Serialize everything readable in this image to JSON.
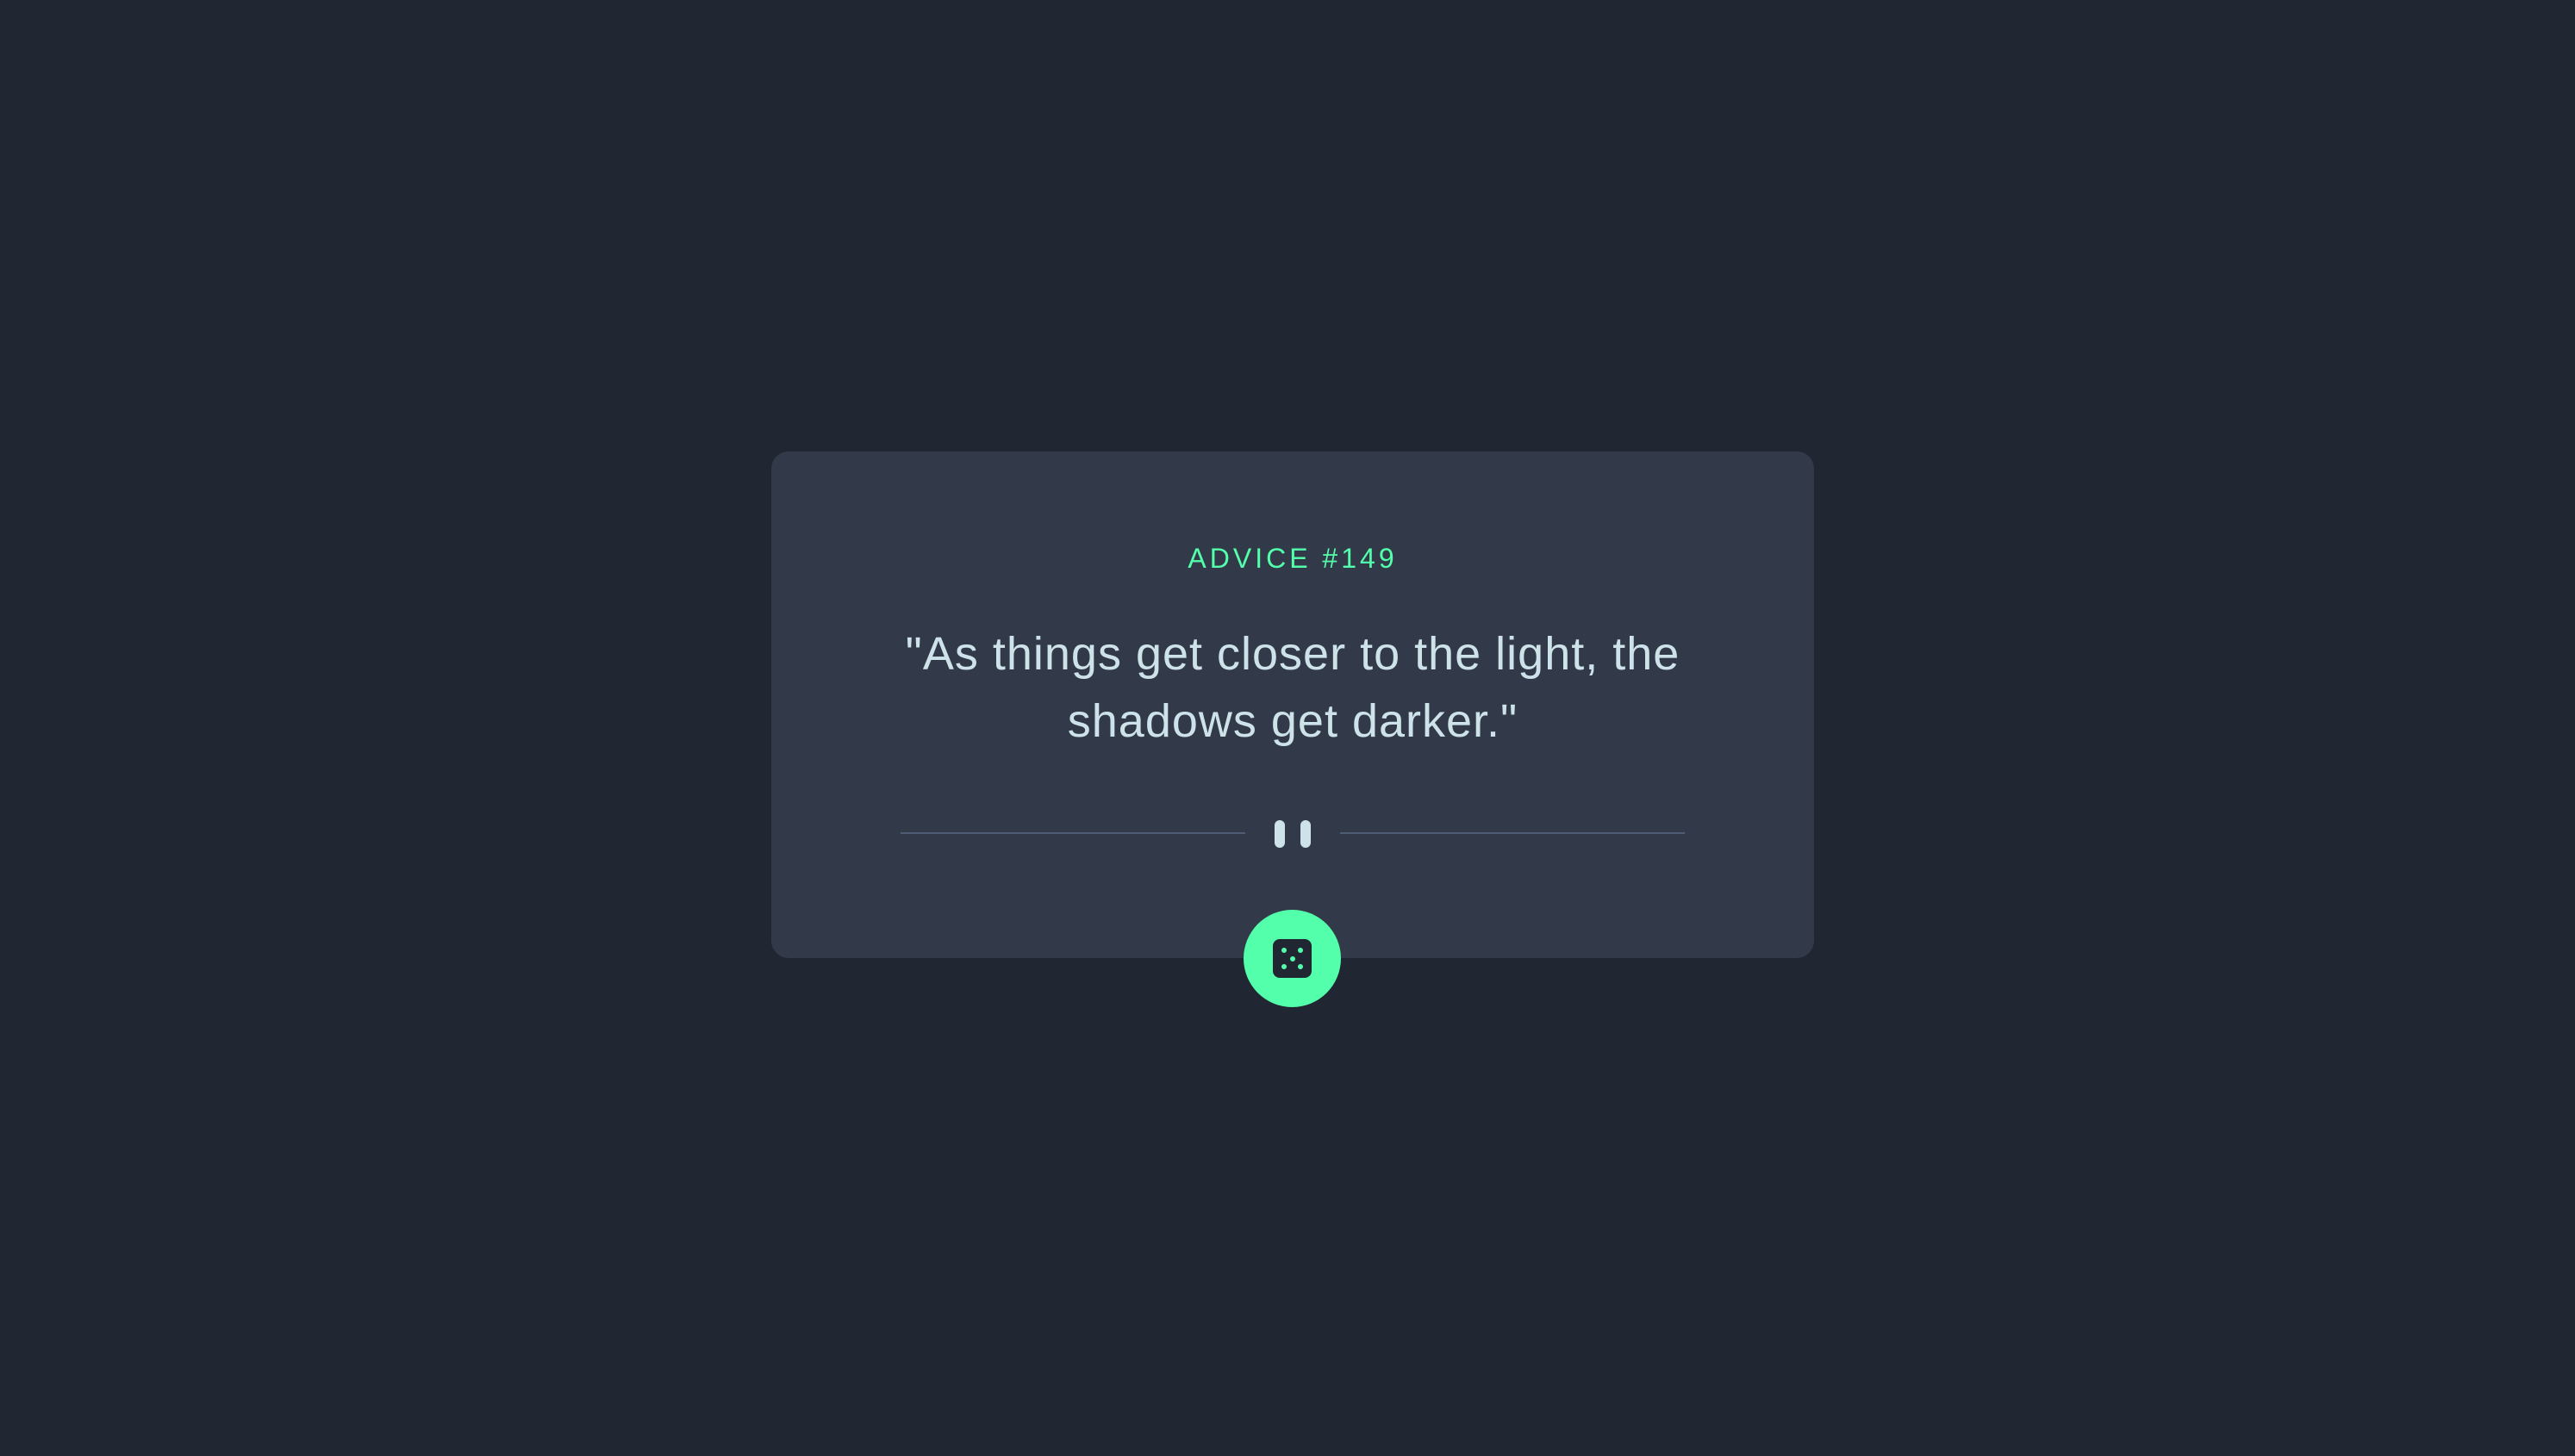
{
  "advice": {
    "id_label": "ADVICE #149",
    "quote": "\"As things get closer to the light, the shadows get darker.\""
  },
  "icons": {
    "divider": "pause-icon",
    "button": "dice-icon"
  },
  "colors": {
    "background": "#202632",
    "card": "#323a49",
    "accent": "#53ffaa",
    "text": "#cee3e9",
    "divider": "#4f5d74"
  }
}
